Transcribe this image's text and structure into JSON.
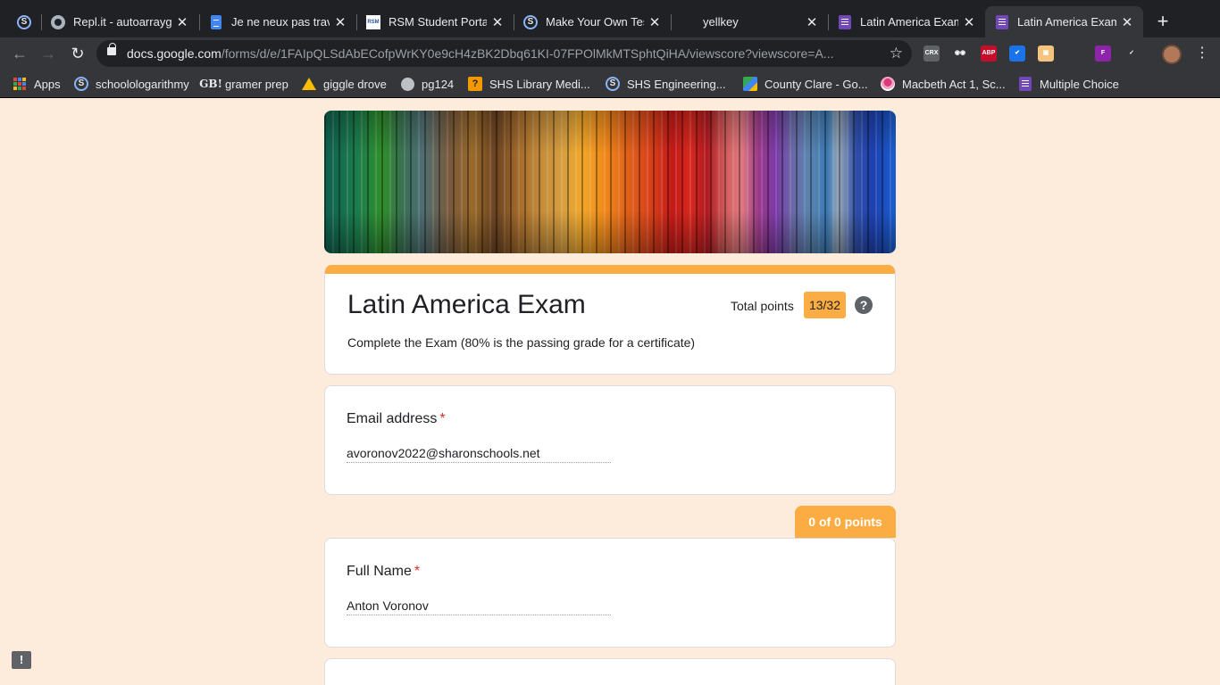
{
  "tabs": [
    {
      "title": "",
      "icon": "schoology-icon",
      "letter": "S"
    },
    {
      "title": "Repl.it - autoarraygen",
      "icon": "replit-icon"
    },
    {
      "title": "Je ne neux pas travailler",
      "icon": "docs-icon"
    },
    {
      "title": "RSM Student Portal",
      "icon": "rsm-icon",
      "icon_text": "RSM"
    },
    {
      "title": "Make Your Own Test",
      "icon": "schoology-icon",
      "letter": "S"
    },
    {
      "title": "yellkey",
      "icon": ""
    },
    {
      "title": "Latin America Exam",
      "icon": "forms-icon"
    },
    {
      "title": "Latin America Exam",
      "icon": "forms-icon",
      "active": true
    }
  ],
  "tab_close_symbol": "✕",
  "new_tab_symbol": "+",
  "toolbar": {
    "url_host": "docs.google.com",
    "url_path": "/forms/d/e/1FAIpQLSdAbECofpWrKY0e9cH4zBK2Dbq61KI-07FPOlMkMTSphtQiHA/viewscore?viewscore=A...",
    "back_symbol": "←",
    "forward_symbol": "→",
    "reload_symbol": "↻",
    "star_symbol": "☆",
    "menu_symbol": "⋮"
  },
  "extensions": [
    {
      "name": "crx-icon",
      "label": "CRX",
      "color": "#5f6368"
    },
    {
      "name": "owl-icon",
      "label": "◉◉",
      "color": "#35363a"
    },
    {
      "name": "abp-icon",
      "label": "ABP",
      "color": "#c70d2c"
    },
    {
      "name": "check-ext-icon",
      "label": "✔",
      "color": "#1a73e8"
    },
    {
      "name": "box-ext-icon",
      "label": "▣",
      "color": "#f4c37d"
    },
    {
      "name": "blank-ext-icon",
      "label": "",
      "color": "#35363a"
    },
    {
      "name": "rainbow-ext-icon",
      "label": "F",
      "color": "#8e24aa"
    },
    {
      "name": "red-ext-icon",
      "label": "✓",
      "color": "#35363a"
    }
  ],
  "bookmarks": [
    {
      "label": "Apps",
      "icon": "apps-icon"
    },
    {
      "label": "schoolologarithmy",
      "icon": "schoology-icon",
      "letter": "S"
    },
    {
      "label": "gramer prep",
      "icon": "gb-icon",
      "icon_text": "GB!"
    },
    {
      "label": "giggle drove",
      "icon": "drive-icon"
    },
    {
      "label": "pg124",
      "icon": "globe-icon"
    },
    {
      "label": "SHS Library Medi...",
      "icon": "library-icon",
      "icon_text": "?"
    },
    {
      "label": "SHS Engineering...",
      "icon": "schoology-icon",
      "letter": "S"
    },
    {
      "label": "County Clare - Go...",
      "icon": "maps-icon"
    },
    {
      "label": "Macbeth Act 1, Sc...",
      "icon": "macbeth-icon"
    },
    {
      "label": "Multiple Choice",
      "icon": "forms-icon"
    }
  ],
  "form": {
    "title": "Latin America Exam",
    "total_points_label": "Total points",
    "score": "13/32",
    "help_symbol": "?",
    "description": "Complete the Exam (80% is the passing grade for a certificate)",
    "required_marker": "*",
    "points_tab": "0 of 0 points",
    "questions": [
      {
        "label": "Email address",
        "answer": "avoronov2022@sharonschools.net"
      },
      {
        "label": "Full Name",
        "answer": "Anton Voronov"
      }
    ]
  },
  "feedback_symbol": "!",
  "colors": {
    "accent": "#fbac43",
    "page_background": "#fdebdc",
    "required": "#d93025"
  }
}
